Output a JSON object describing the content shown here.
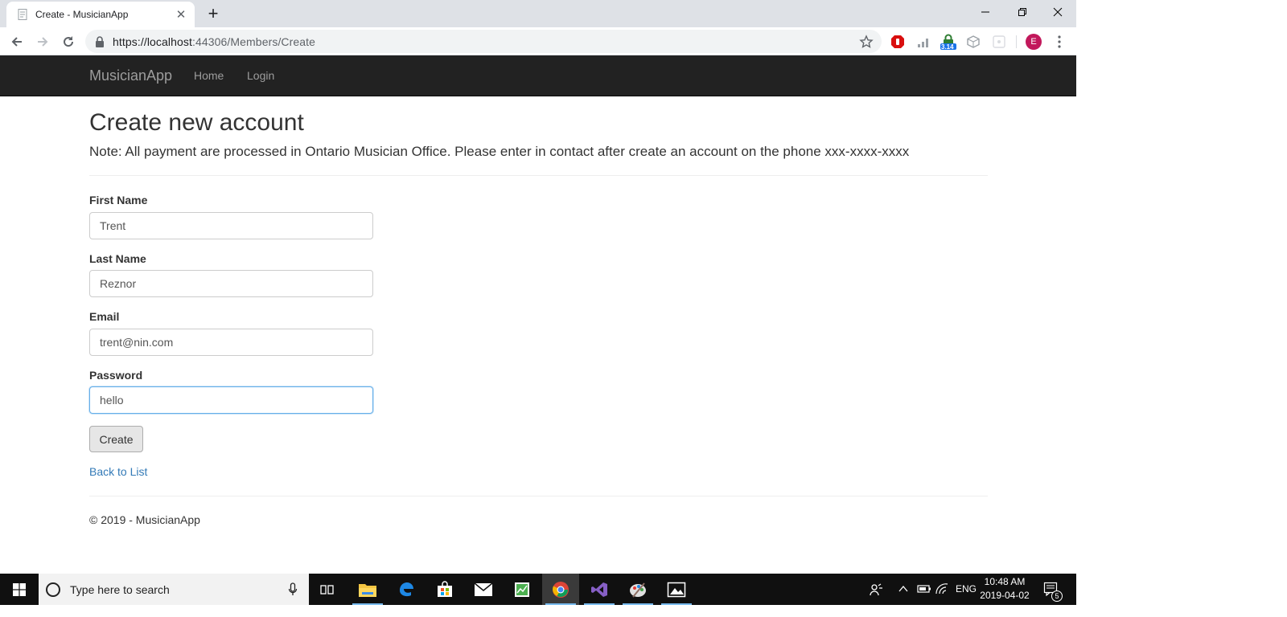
{
  "browser": {
    "tab_title": "Create - MusicianApp",
    "url_host": "https://localhost",
    "url_rest": ":44306/Members/Create",
    "extension_badge": "3.14",
    "profile_initial": "E"
  },
  "site": {
    "brand": "MusicianApp",
    "nav": {
      "home": "Home",
      "login": "Login"
    },
    "page_title": "Create new account",
    "note": "Note: All payment are processed in Ontario Musician Office. Please enter in contact after create an account on the phone xxx-xxxx-xxxx",
    "form": {
      "first_name_label": "First Name",
      "first_name_value": "Trent",
      "last_name_label": "Last Name",
      "last_name_value": "Reznor",
      "email_label": "Email",
      "email_value": "trent@nin.com",
      "password_label": "Password",
      "password_value": "hello",
      "submit_label": "Create"
    },
    "back_link": "Back to List",
    "footer": "© 2019 - MusicianApp"
  },
  "taskbar": {
    "search_placeholder": "Type here to search",
    "language": "ENG",
    "time": "10:48 AM",
    "date": "2019-04-02",
    "notification_count": "5"
  }
}
